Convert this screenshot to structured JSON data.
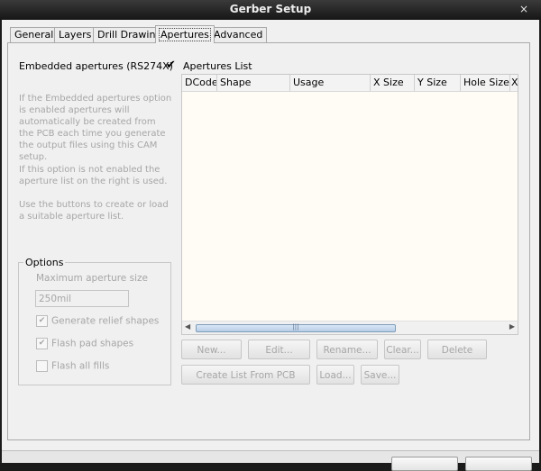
{
  "window": {
    "title": "Gerber Setup",
    "close_glyph": "×"
  },
  "tabs": [
    {
      "label": "General"
    },
    {
      "label": "Layers"
    },
    {
      "label": "Drill Drawing"
    },
    {
      "label": "Apertures"
    },
    {
      "label": "Advanced"
    }
  ],
  "selected_tab": "Apertures",
  "embedded": {
    "label": "Embedded apertures (RS274X)",
    "checked": true
  },
  "help": {
    "p1": "If the Embedded apertures option is enabled apertures will automatically be created from the PCB each time you generate the output files using this CAM setup.",
    "p2": "If this option is not enabled the aperture list on the right is used.",
    "p3": "Use the buttons to create or load a suitable aperture list."
  },
  "options": {
    "title": "Options",
    "max_size_label": "Maximum aperture size",
    "max_size_value": "250mil",
    "generate_relief": {
      "label": "Generate relief shapes",
      "checked": true
    },
    "flash_pad": {
      "label": "Flash pad shapes",
      "checked": true
    },
    "flash_all": {
      "label": "Flash all fills",
      "checked": false
    }
  },
  "apertures_list": {
    "title": "Apertures List",
    "columns": [
      "DCode",
      "Shape",
      "Usage",
      "X Size",
      "Y Size",
      "Hole Size",
      "X"
    ],
    "rows": []
  },
  "buttons": {
    "new": "New...",
    "edit": "Edit...",
    "rename": "Rename...",
    "clear": "Clear...",
    "delete": "Delete",
    "create_list": "Create List From PCB",
    "load": "Load...",
    "save": "Save..."
  },
  "colors": {
    "titlebar": "#1b1b1b",
    "list_background": "#fffcf5",
    "disabled_text": "#a6a6a6"
  }
}
